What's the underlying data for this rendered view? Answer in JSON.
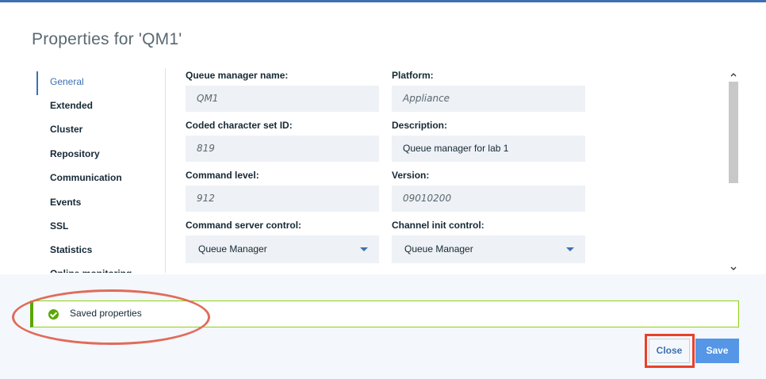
{
  "dialog": {
    "title": "Properties for 'QM1'"
  },
  "nav": {
    "items": [
      {
        "label": "General",
        "active": true
      },
      {
        "label": "Extended"
      },
      {
        "label": "Cluster"
      },
      {
        "label": "Repository"
      },
      {
        "label": "Communication"
      },
      {
        "label": "Events"
      },
      {
        "label": "SSL"
      },
      {
        "label": "Statistics"
      },
      {
        "label": "Online monitoring"
      }
    ]
  },
  "form": {
    "qm_name": {
      "label": "Queue manager name:",
      "value": "QM1"
    },
    "platform": {
      "label": "Platform:",
      "value": "Appliance"
    },
    "ccsid": {
      "label": "Coded character set ID:",
      "value": "819"
    },
    "description": {
      "label": "Description:",
      "value": "Queue manager for lab 1"
    },
    "command_level": {
      "label": "Command level:",
      "value": "912"
    },
    "version": {
      "label": "Version:",
      "value": "09010200"
    },
    "cmd_server_control": {
      "label": "Command server control:",
      "value": "Queue Manager"
    },
    "channel_init_control": {
      "label": "Channel init control:",
      "value": "Queue Manager"
    }
  },
  "notification": {
    "message": "Saved properties",
    "status_color": "#5aa700"
  },
  "buttons": {
    "close": "Close",
    "save": "Save"
  },
  "colors": {
    "accent": "#3d70b2",
    "primary_button": "#5596e6",
    "annotation": "#e8412b"
  }
}
